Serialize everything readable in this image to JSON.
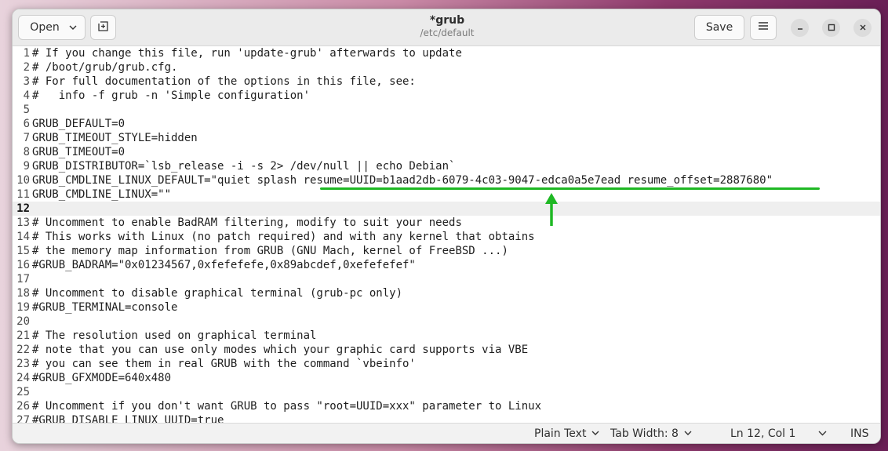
{
  "header": {
    "open_label": "Open",
    "title": "*grub",
    "subtitle": "/etc/default",
    "save_label": "Save"
  },
  "icons": {
    "open_chevron": "chevron-down-icon",
    "new_tab": "new-tab-icon",
    "menu": "hamburger-menu-icon",
    "minimize": "minimize-icon",
    "maximize": "maximize-icon",
    "close": "close-icon"
  },
  "editor": {
    "current_line": 12,
    "lines": [
      {
        "n": "1",
        "text": "# If you change this file, run 'update-grub' afterwards to update"
      },
      {
        "n": "2",
        "text": "# /boot/grub/grub.cfg."
      },
      {
        "n": "3",
        "text": "# For full documentation of the options in this file, see:"
      },
      {
        "n": "4",
        "text": "#   info -f grub -n 'Simple configuration'"
      },
      {
        "n": "5",
        "text": ""
      },
      {
        "n": "6",
        "text": "GRUB_DEFAULT=0"
      },
      {
        "n": "7",
        "text": "GRUB_TIMEOUT_STYLE=hidden"
      },
      {
        "n": "8",
        "text": "GRUB_TIMEOUT=0"
      },
      {
        "n": "9",
        "text": "GRUB_DISTRIBUTOR=`lsb_release -i -s 2> /dev/null || echo Debian`"
      },
      {
        "n": "10",
        "text": "GRUB_CMDLINE_LINUX_DEFAULT=\"quiet splash resume=UUID=b1aad2db-6079-4c03-9047-edca0a5e7ead resume_offset=2887680\""
      },
      {
        "n": "11",
        "text": "GRUB_CMDLINE_LINUX=\"\""
      },
      {
        "n": "12",
        "text": ""
      },
      {
        "n": "13",
        "text": "# Uncomment to enable BadRAM filtering, modify to suit your needs"
      },
      {
        "n": "14",
        "text": "# This works with Linux (no patch required) and with any kernel that obtains"
      },
      {
        "n": "15",
        "text": "# the memory map information from GRUB (GNU Mach, kernel of FreeBSD ...)"
      },
      {
        "n": "16",
        "text": "#GRUB_BADRAM=\"0x01234567,0xfefefefe,0x89abcdef,0xefefefef\""
      },
      {
        "n": "17",
        "text": ""
      },
      {
        "n": "18",
        "text": "# Uncomment to disable graphical terminal (grub-pc only)"
      },
      {
        "n": "19",
        "text": "#GRUB_TERMINAL=console"
      },
      {
        "n": "20",
        "text": ""
      },
      {
        "n": "21",
        "text": "# The resolution used on graphical terminal"
      },
      {
        "n": "22",
        "text": "# note that you can use only modes which your graphic card supports via VBE"
      },
      {
        "n": "23",
        "text": "# you can see them in real GRUB with the command `vbeinfo'"
      },
      {
        "n": "24",
        "text": "#GRUB_GFXMODE=640x480"
      },
      {
        "n": "25",
        "text": ""
      },
      {
        "n": "26",
        "text": "# Uncomment if you don't want GRUB to pass \"root=UUID=xxx\" parameter to Linux"
      },
      {
        "n": "27",
        "text": "#GRUB_DISABLE_LINUX_UUID=true"
      }
    ]
  },
  "statusbar": {
    "language": "Plain Text",
    "tab_width": "Tab Width: 8",
    "position": "Ln 12, Col 1",
    "mode": "INS"
  },
  "colors": {
    "annotation": "#1fb824"
  }
}
